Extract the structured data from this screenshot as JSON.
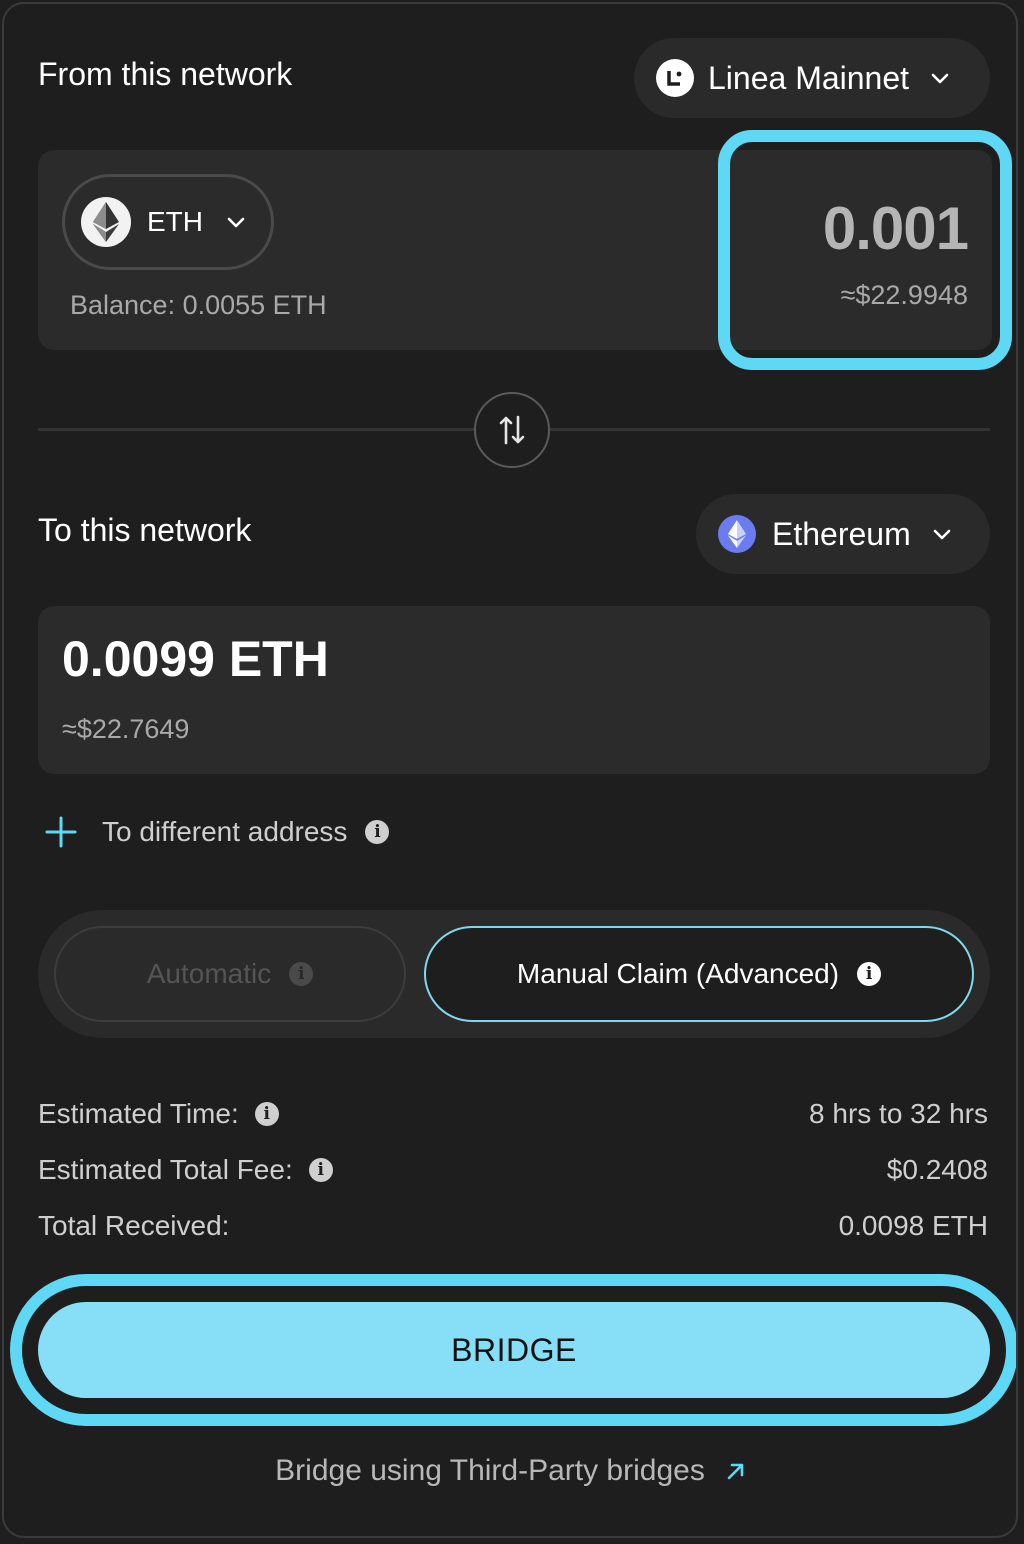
{
  "from": {
    "label": "From this network",
    "network": "Linea Mainnet",
    "token": "ETH",
    "balance": "Balance: 0.0055 ETH",
    "amount": "0.001",
    "amount_usd": "≈$22.9948"
  },
  "to": {
    "label": "To this network",
    "network": "Ethereum",
    "amount": "0.0099 ETH",
    "amount_usd": "≈$22.7649"
  },
  "different_address": "To different address",
  "claim": {
    "automatic": "Automatic",
    "manual": "Manual Claim (Advanced)"
  },
  "summary": {
    "time_label": "Estimated Time:",
    "time_value": "8 hrs to 32 hrs",
    "fee_label": "Estimated Total Fee:",
    "fee_value": "$0.2408",
    "received_label": "Total Received:",
    "received_value": "0.0098 ETH"
  },
  "bridge_button": "BRIDGE",
  "third_party_link": "Bridge using Third-Party bridges",
  "colors": {
    "accent": "#5fd8f5",
    "bridge_button": "#86dff7",
    "background": "#1e1e1e",
    "panel": "#2b2b2b"
  }
}
